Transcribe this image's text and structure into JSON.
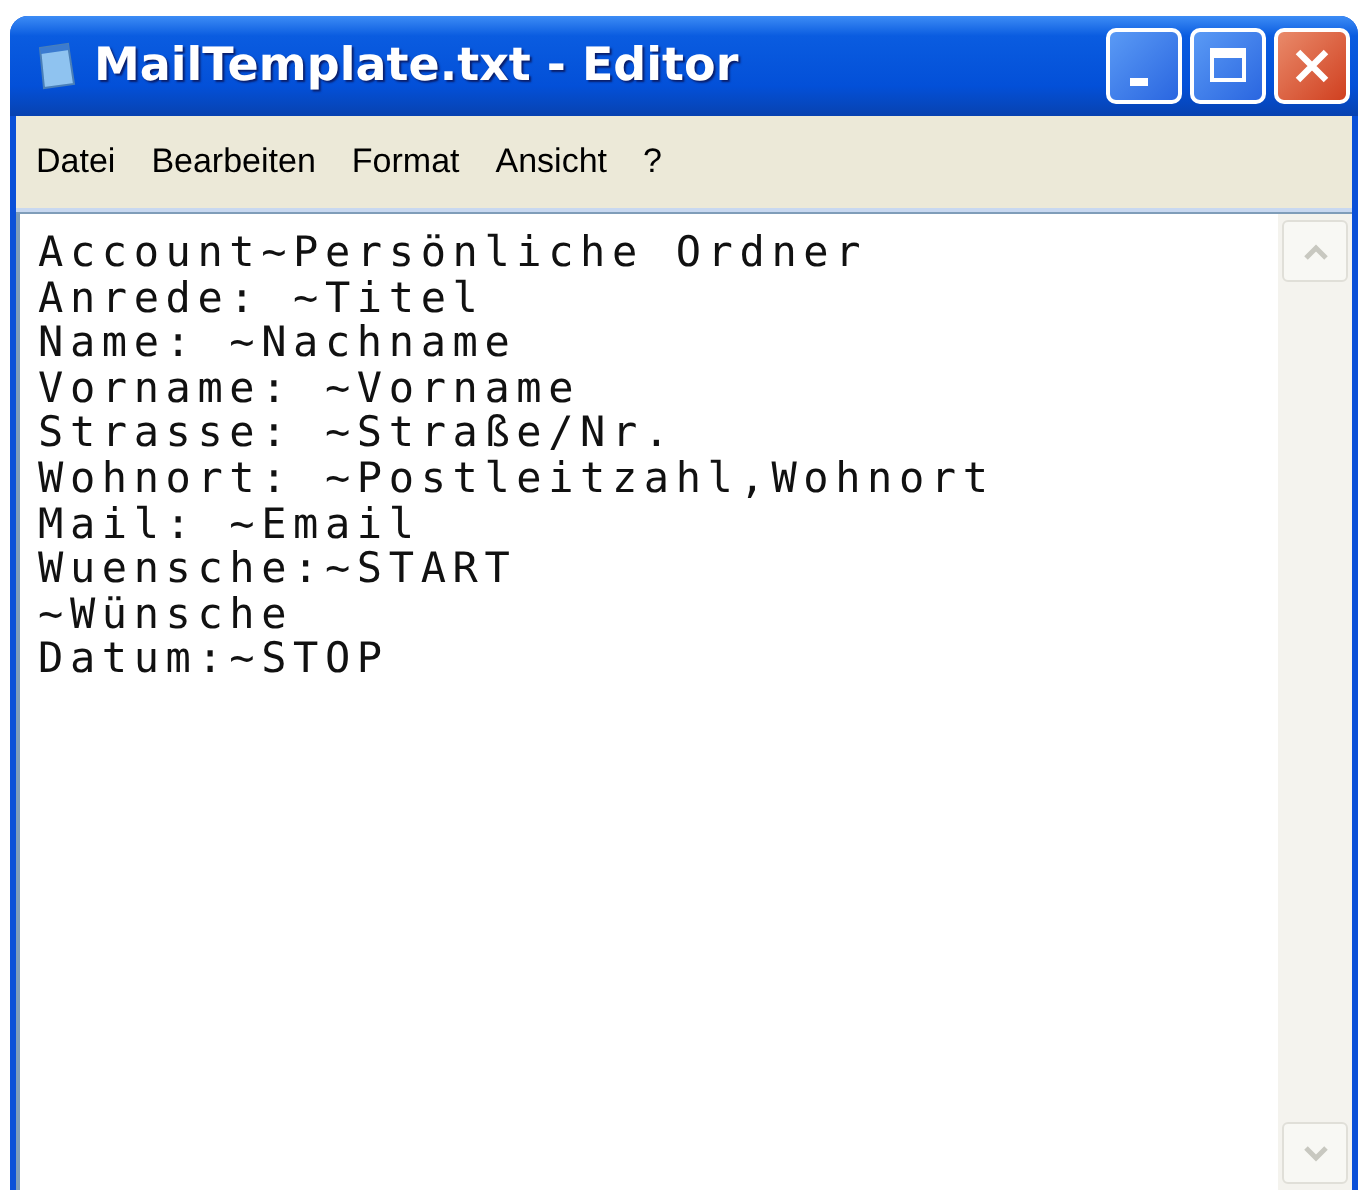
{
  "window": {
    "title": "MailTemplate.txt - Editor"
  },
  "menu": [
    "Datei",
    "Bearbeiten",
    "Format",
    "Ansicht",
    "?"
  ],
  "editor": {
    "lines": [
      "Account~Persönliche Ordner",
      "Anrede: ~Titel",
      "Name: ~Nachname",
      "Vorname: ~Vorname",
      "Strasse: ~Straße/Nr.",
      "Wohnort: ~Postleitzahl,Wohnort",
      "Mail: ~Email",
      "Wuensche:~START",
      "~Wünsche",
      "Datum:~STOP"
    ]
  }
}
